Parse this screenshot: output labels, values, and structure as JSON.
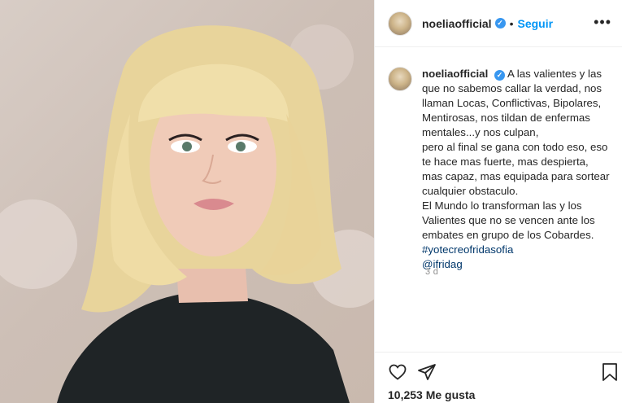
{
  "post": {
    "username": "noeliaofficial",
    "verified_mark": "✓",
    "separator": "•",
    "follow_label": "Seguir",
    "more_label": "•••",
    "caption_username": "noeliaofficial",
    "caption_lines": [
      "A las valientes y las",
      "que no sabemos callar la verdad, nos",
      "llaman Locas, Conflictivas, Bipolares,",
      "Mentirosas, nos tildan de enfermas",
      "mentales...y nos culpan,",
      "pero al final se gana con todo eso, eso",
      "te hace mas fuerte, mas despierta,",
      "mas capaz, mas equipada para sortear",
      "cualquier obstaculo.",
      "El Mundo lo transforman las y los",
      "Valientes que no se vencen ante los",
      "embates en grupo de los Cobardes."
    ],
    "hashtag": "#yotecreofridasofia",
    "mention": "@ifridag",
    "time_ago": "3 d",
    "likes": "10,253 Me gusta"
  },
  "icons": {
    "like": "heart-icon",
    "share": "paper-plane-icon",
    "save": "bookmark-icon"
  },
  "colors": {
    "accent": "#0095f6",
    "verified": "#3897f0",
    "link": "#00376b",
    "muted": "#8e8e8e",
    "border": "#efefef"
  }
}
